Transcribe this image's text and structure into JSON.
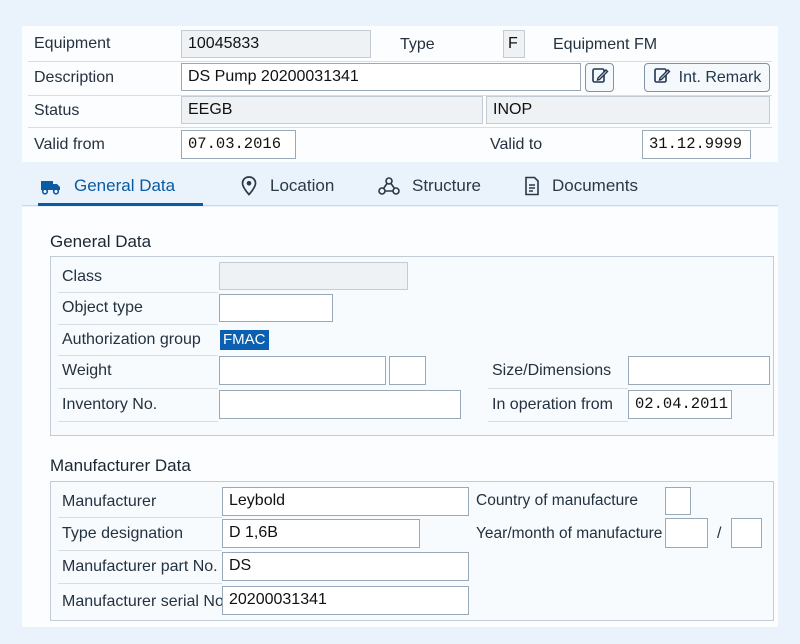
{
  "header": {
    "equipment_label": "Equipment",
    "equipment_value": "10045833",
    "type_label": "Type",
    "type_value": "F",
    "equipment_type_text": "Equipment FM",
    "description_label": "Description",
    "description_value": "DS Pump 20200031341",
    "int_remark_label": "Int. Remark",
    "status_label": "Status",
    "status_value": "EEGB",
    "status_user_value": "INOP",
    "valid_from_label": "Valid from",
    "valid_from_value": "07.03.2016",
    "valid_to_label": "Valid to",
    "valid_to_value": "31.12.9999"
  },
  "tabs": [
    {
      "label": "General Data",
      "icon": "truck-icon",
      "active": true
    },
    {
      "label": "Location",
      "icon": "location-pin-icon",
      "active": false
    },
    {
      "label": "Structure",
      "icon": "hierarchy-icon",
      "active": false
    },
    {
      "label": "Documents",
      "icon": "document-icon",
      "active": false
    }
  ],
  "general": {
    "title": "General Data",
    "class_label": "Class",
    "class_value": "",
    "object_type_label": "Object type",
    "object_type_value": "",
    "auth_group_label": "Authorization group",
    "auth_group_value": "FMAC",
    "weight_label": "Weight",
    "weight_value": "",
    "weight_unit": "",
    "size_label": "Size/Dimensions",
    "size_value": "",
    "inventory_label": "Inventory No.",
    "inventory_value": "",
    "in_operation_label": "In operation from",
    "in_operation_value": "02.04.2011"
  },
  "manufacturer": {
    "title": "Manufacturer Data",
    "manufacturer_label": "Manufacturer",
    "manufacturer_value": "Leybold",
    "country_label": "Country of manufacture",
    "country_value": "",
    "type_designation_label": "Type designation",
    "type_designation_value": "D 1,6B",
    "year_month_label": "Year/month of manufacture",
    "year_value": "",
    "separator": "/",
    "month_value": "",
    "part_no_label": "Manufacturer part No.",
    "part_no_value": "DS",
    "serial_no_label": "Manufacturer serial No.",
    "serial_no_value": "20200031341"
  },
  "colors": {
    "accent": "#0b5aa2",
    "highlight": "#0a5fb0",
    "background": "#eaf3fb"
  }
}
